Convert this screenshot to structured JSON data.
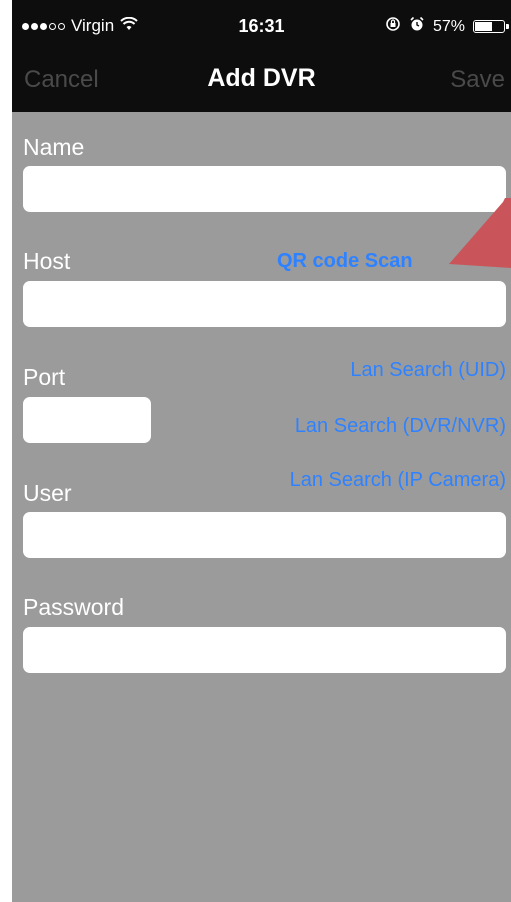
{
  "status_bar": {
    "carrier": "Virgin",
    "time": "16:31",
    "battery": "57%",
    "battery_level": 0.57
  },
  "nav": {
    "cancel": "Cancel",
    "title": "Add DVR",
    "save": "Save"
  },
  "form": {
    "name_label": "Name",
    "name_value": "",
    "host_label": "Host",
    "host_value": "",
    "port_label": "Port",
    "port_value": "",
    "user_label": "User",
    "user_value": "",
    "password_label": "Password",
    "password_value": ""
  },
  "links": {
    "qr_scan": "QR code Scan",
    "lan_uid": "Lan Search (UID)",
    "lan_dvr": "Lan Search (DVR/NVR)",
    "lan_ip": "Lan Search (IP Camera)"
  },
  "colors": {
    "background": "#9b9b9b",
    "bar": "#0d0d0d",
    "link": "#2f82ff",
    "arrow": "#c9555a"
  },
  "icons": [
    "signal-dots-icon",
    "wifi-icon",
    "orientation-lock-icon",
    "alarm-icon",
    "battery-icon",
    "red-pointer-arrow"
  ]
}
